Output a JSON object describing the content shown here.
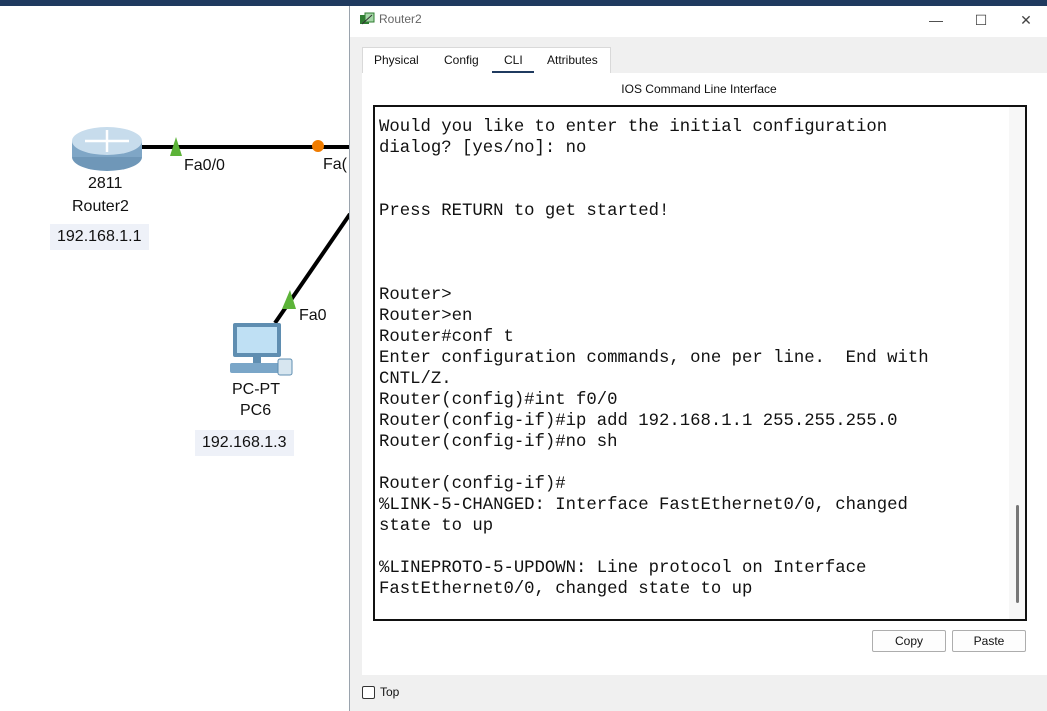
{
  "workspace": {
    "router": {
      "model": "2811",
      "name": "Router2",
      "ip": "192.168.1.1",
      "port": "Fa0/0"
    },
    "pc": {
      "model": "PC-PT",
      "name": "PC6",
      "ip": "192.168.1.3",
      "port": "Fa0"
    },
    "partial_port_label": "Fa(",
    "colors": {
      "link": "#000000",
      "link_up": "#5cb338",
      "link_pending": "#f07c00"
    }
  },
  "window": {
    "title": "Router2",
    "controls": {
      "minimize": "—",
      "maximize": "☐",
      "close": "✕"
    },
    "tabs": [
      {
        "label": "Physical"
      },
      {
        "label": "Config"
      },
      {
        "label": "CLI"
      },
      {
        "label": "Attributes"
      }
    ],
    "active_tab": "CLI",
    "panel_title": "IOS Command Line Interface",
    "terminal_text": "Would you like to enter the initial configuration\ndialog? [yes/no]: no\n\n\nPress RETURN to get started!\n\n\n\nRouter>\nRouter>en\nRouter#conf t\nEnter configuration commands, one per line.  End with\nCNTL/Z.\nRouter(config)#int f0/0\nRouter(config-if)#ip add 192.168.1.1 255.255.255.0\nRouter(config-if)#no sh\n\nRouter(config-if)#\n%LINK-5-CHANGED: Interface FastEthernet0/0, changed\nstate to up\n\n%LINEPROTO-5-UPDOWN: Line protocol on Interface\nFastEthernet0/0, changed state to up",
    "buttons": {
      "copy": "Copy",
      "paste": "Paste"
    },
    "top_checkbox": {
      "label": "Top",
      "checked": false
    }
  }
}
